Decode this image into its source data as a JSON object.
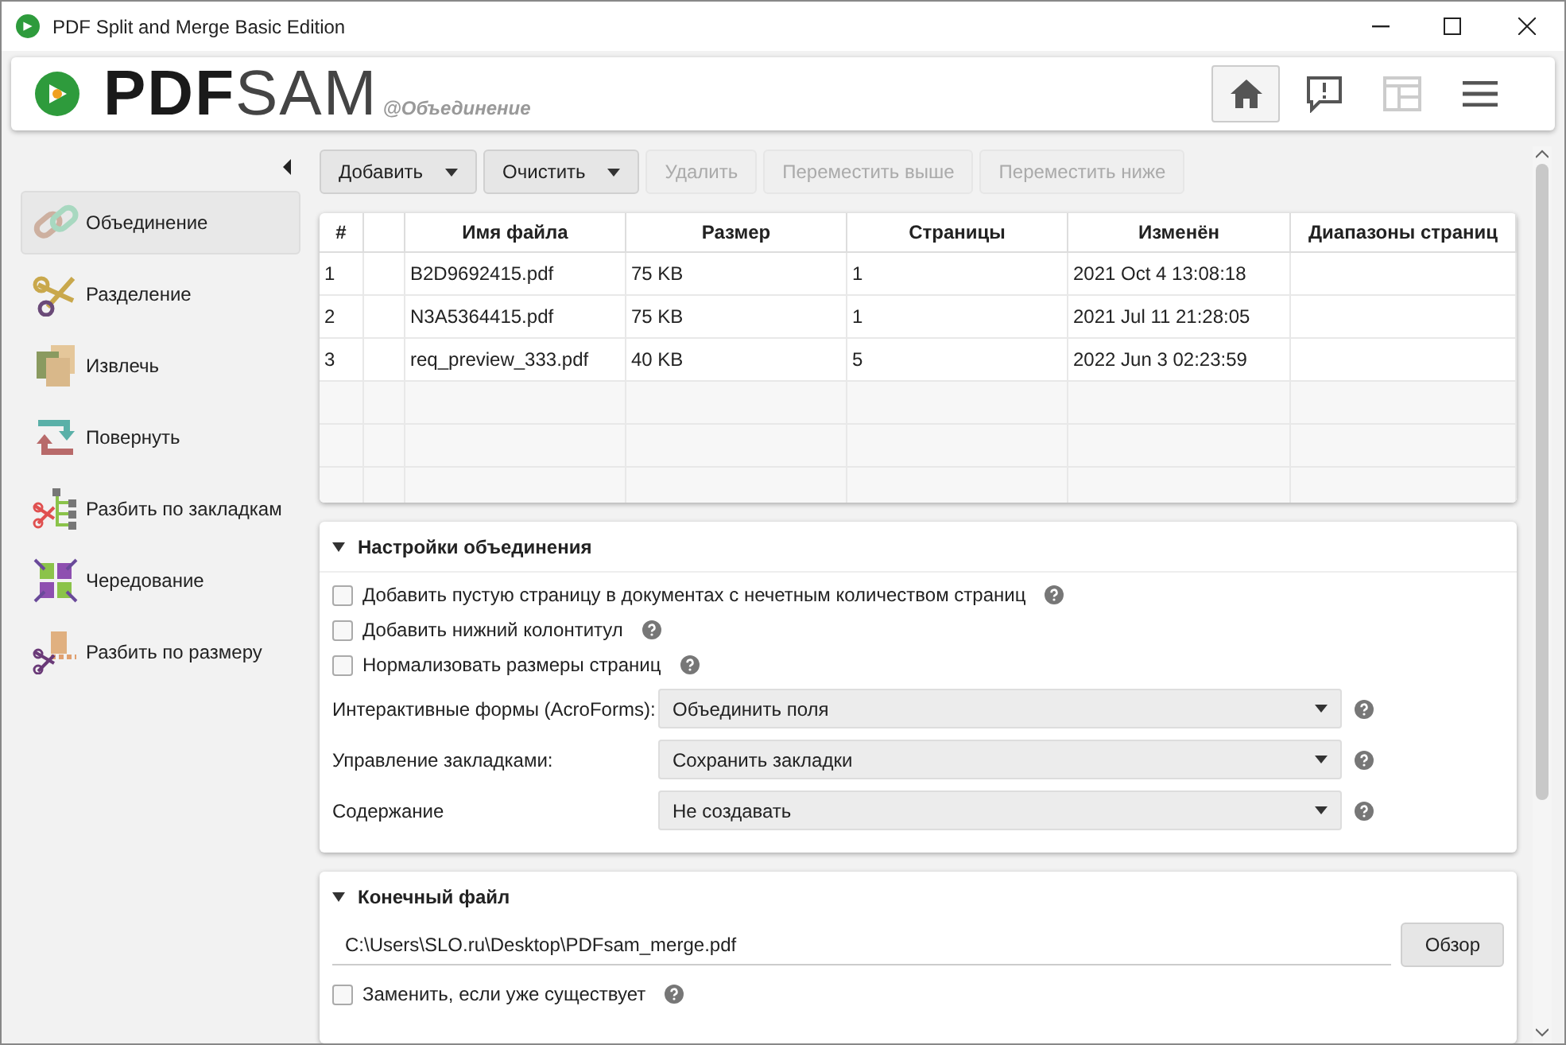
{
  "window": {
    "title": "PDF Split and Merge Basic Edition"
  },
  "header": {
    "logo_dark": "PDF",
    "logo_light": "SAM",
    "subtitle": "@Объединение",
    "buttons": [
      {
        "kind": "home",
        "selected": true,
        "disabled": false
      },
      {
        "kind": "feedback",
        "selected": false,
        "disabled": false
      },
      {
        "kind": "dashboard",
        "selected": false,
        "disabled": true
      },
      {
        "kind": "menu",
        "selected": false,
        "disabled": false
      }
    ]
  },
  "sidebar": {
    "items": [
      {
        "kind": "merge",
        "label": "Объединение",
        "selected": true
      },
      {
        "kind": "split",
        "label": "Разделение",
        "selected": false
      },
      {
        "kind": "extract",
        "label": "Извлечь",
        "selected": false
      },
      {
        "kind": "rotate",
        "label": "Повернуть",
        "selected": false
      },
      {
        "kind": "bookmarks",
        "label": "Разбить по закладкам",
        "selected": false
      },
      {
        "kind": "alternate",
        "label": "Чередование",
        "selected": false
      },
      {
        "kind": "size",
        "label": "Разбить по размеру",
        "selected": false
      }
    ]
  },
  "toolbar": [
    {
      "label": "Добавить",
      "dropdown": true,
      "disabled": false
    },
    {
      "label": "Очистить",
      "dropdown": true,
      "disabled": false
    },
    {
      "label": "Удалить",
      "dropdown": false,
      "disabled": true
    },
    {
      "label": "Переместить выше",
      "dropdown": false,
      "disabled": true
    },
    {
      "label": "Переместить ниже",
      "dropdown": false,
      "disabled": true
    }
  ],
  "table": {
    "columns": [
      "#",
      "Имя файла",
      "Размер",
      "Страницы",
      "Изменён",
      "Диапазоны страниц"
    ],
    "rows": [
      [
        "1",
        "B2D9692415.pdf",
        "75 KB",
        "1",
        "2021 Oct 4 13:08:18"
      ],
      [
        "2",
        "N3A5364415.pdf",
        "75 KB",
        "1",
        "2021 Jul 11 21:28:05"
      ],
      [
        "3",
        "req_preview_333.pdf",
        "40 KB",
        "5",
        "2022 Jun 3 02:23:59"
      ]
    ]
  },
  "merge_settings": {
    "title": "Настройки объединения",
    "expanded": true,
    "checkboxes": [
      {
        "label": "Добавить пустую страницу в документах с нечетным количеством страниц",
        "checked": false
      },
      {
        "label": "Добавить нижний колонтитул",
        "checked": false
      },
      {
        "label": "Нормализовать размеры страниц",
        "checked": false
      }
    ],
    "selects": [
      {
        "label": "Интерактивные формы (AcroForms):",
        "value": "Объединить поля"
      },
      {
        "label": "Управление закладками:",
        "value": "Сохранить закладки"
      },
      {
        "label": "Содержание",
        "value": "Не создавать"
      }
    ]
  },
  "output": {
    "title": "Конечный файл",
    "expanded": true,
    "path": "C:\\Users\\SLO.ru\\Desktop\\PDFsam_merge.pdf",
    "browse": "Обзор",
    "checkbox": {
      "label": "Заменить, если уже существует",
      "checked": false
    }
  }
}
